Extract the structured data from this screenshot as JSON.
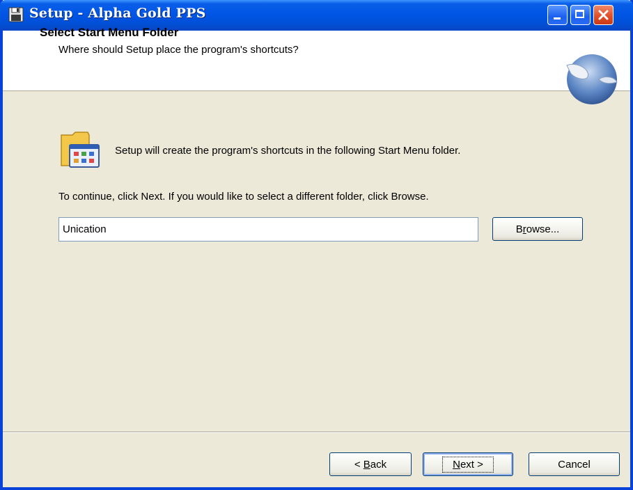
{
  "window": {
    "title": "Setup - Alpha Gold PPS"
  },
  "header": {
    "title": "Select Start Menu Folder",
    "subtitle": "Where should Setup place the program's shortcuts?"
  },
  "body": {
    "info_text": "Setup will create the program's shortcuts in the following Start Menu folder.",
    "continue_text": "To continue, click Next. If you would like to select a different folder, click Browse.",
    "folder_value": "Unication"
  },
  "buttons": {
    "browse": {
      "mnemonic": "r",
      "pre": "B",
      "post": "owse..."
    },
    "back": {
      "pre": "< ",
      "mnemonic": "B",
      "post": "ack"
    },
    "next": {
      "pre": "",
      "mnemonic": "N",
      "post": "ext >"
    },
    "cancel": "Cancel"
  },
  "icons": {
    "title": "floppy-disk-icon",
    "header": "setup-wizard-icon",
    "folder": "start-menu-folder-icon"
  },
  "colors": {
    "titlebar": "#0055e5",
    "dialog_bg": "#ece9d8",
    "close": "#e0502a"
  }
}
